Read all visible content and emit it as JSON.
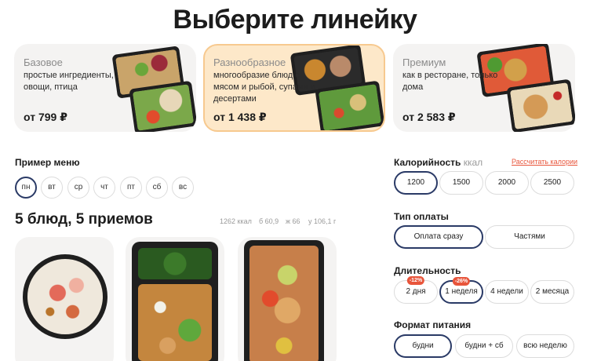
{
  "title": "Выберите линейку",
  "plans": [
    {
      "name": "Базовое",
      "desc": "простые ингредиенты, овощи, птица",
      "price": "от 799 ₽"
    },
    {
      "name": "Разнообразное",
      "desc": "многообразие блюд с мясом и рыбой, супами и десертами",
      "price": "от 1 438 ₽"
    },
    {
      "name": "Премиум",
      "desc": "как в ресторане, только дома",
      "price": "от 2 583 ₽"
    }
  ],
  "menu": {
    "label": "Пример меню",
    "days": [
      "пн",
      "вт",
      "ср",
      "чт",
      "пт",
      "сб",
      "вс"
    ],
    "meals_title": "5 блюд, 5 приемов",
    "stats": [
      "1262 ккал",
      "б 60,9",
      "ж 66",
      "у 106,1 г"
    ]
  },
  "calories": {
    "label": "Калорийность",
    "unit": "ккал",
    "calc_link": "Рассчитать калории",
    "options": [
      "1200",
      "1500",
      "2000",
      "2500"
    ]
  },
  "payment": {
    "label": "Тип оплаты",
    "options": [
      "Оплата сразу",
      "Частями"
    ]
  },
  "duration": {
    "label": "Длительность",
    "options": [
      {
        "label": "2 дня",
        "badge": "-12%"
      },
      {
        "label": "1 неделя",
        "badge": "-26%"
      },
      {
        "label": "4 недели",
        "badge": ""
      },
      {
        "label": "2 месяца",
        "badge": ""
      }
    ]
  },
  "format": {
    "label": "Формат питания",
    "options": [
      "будни",
      "будни + сб",
      "всю неделю"
    ]
  },
  "colors": {
    "accent": "#e8553b",
    "selected_border": "#2a3a66",
    "active_plan_bg": "#fde8c9"
  }
}
